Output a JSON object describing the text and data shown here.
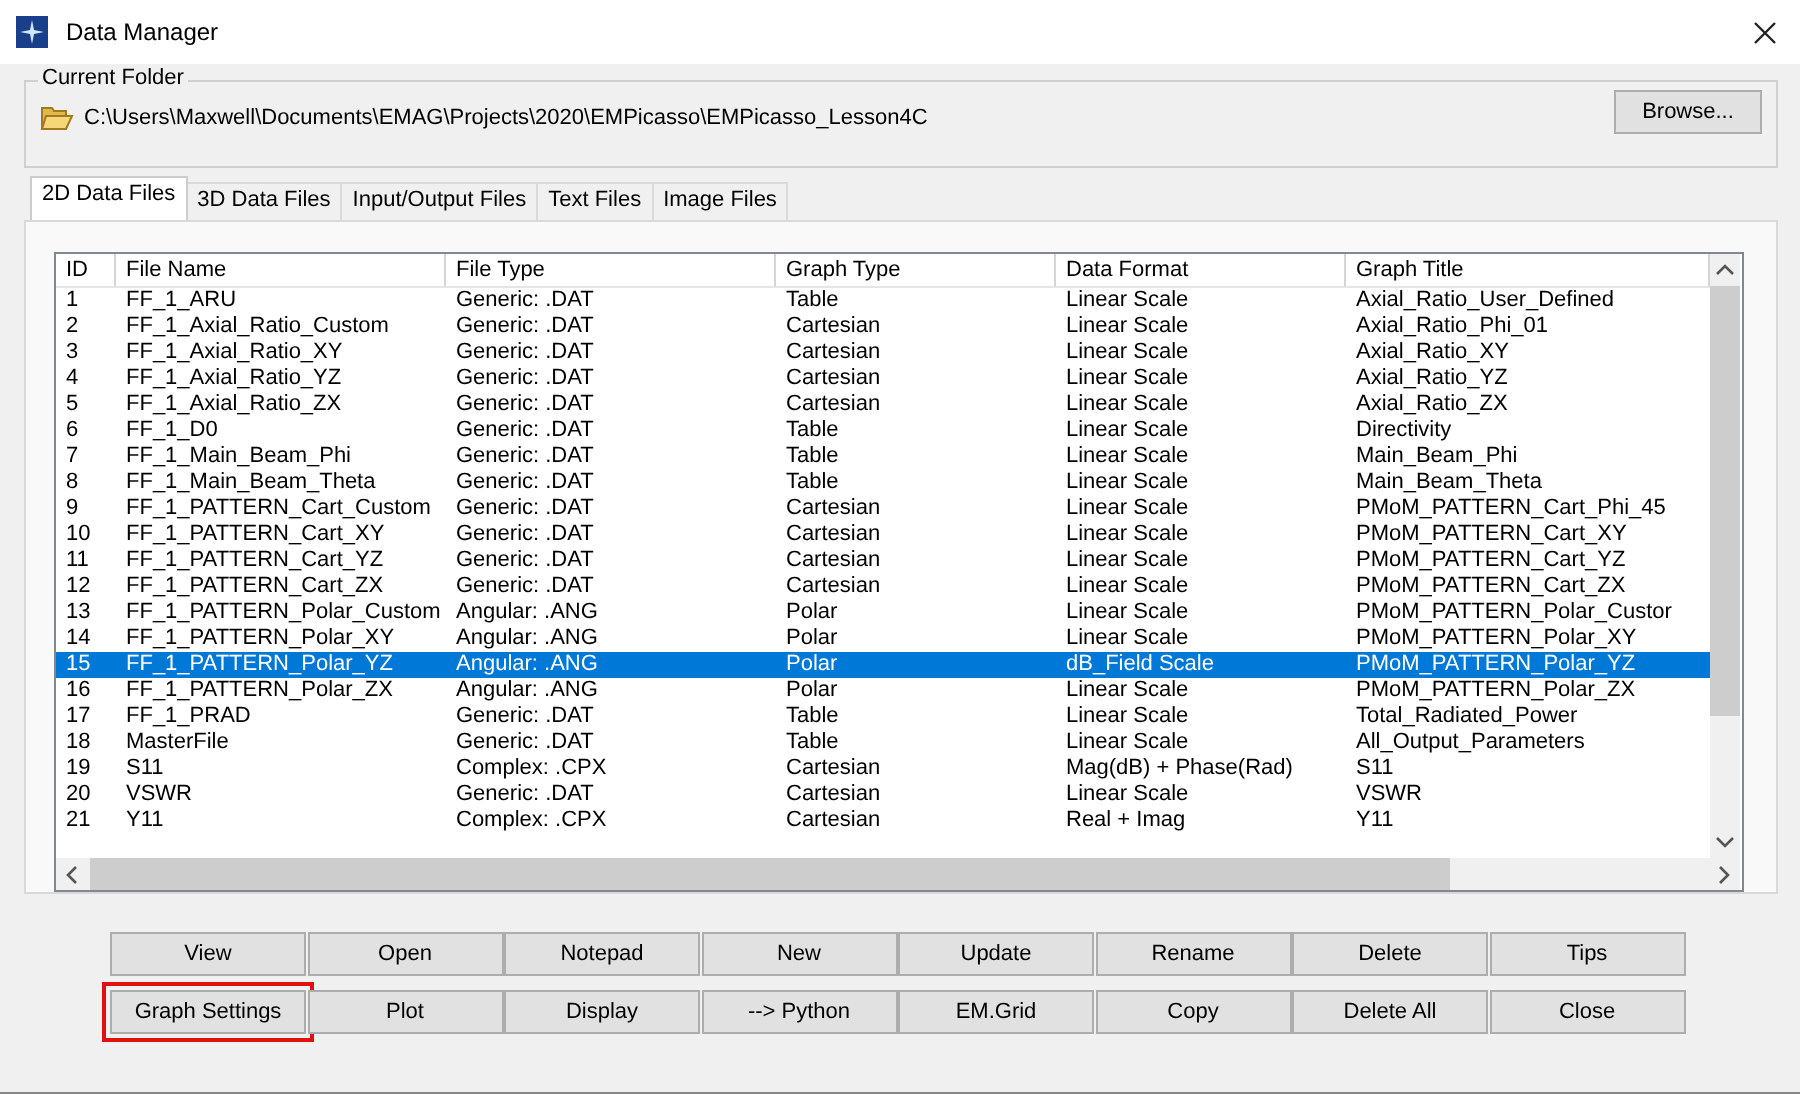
{
  "window": {
    "title": "Data Manager"
  },
  "current_folder": {
    "label": "Current Folder",
    "path": "C:\\Users\\Maxwell\\Documents\\EMAG\\Projects\\2020\\EMPicasso\\EMPicasso_Lesson4C",
    "browse_button": "Browse..."
  },
  "tabs": [
    {
      "label": "2D Data Files",
      "selected": true
    },
    {
      "label": "3D Data Files",
      "selected": false
    },
    {
      "label": "Input/Output Files",
      "selected": false
    },
    {
      "label": "Text Files",
      "selected": false
    },
    {
      "label": "Image Files",
      "selected": false
    }
  ],
  "table": {
    "columns": [
      "ID",
      "File Name",
      "File Type",
      "Graph Type",
      "Data Format",
      "Graph Title"
    ],
    "rows": [
      {
        "cells": [
          "1",
          "FF_1_ARU",
          "Generic: .DAT",
          "Table",
          "Linear Scale",
          "Axial_Ratio_User_Defined"
        ],
        "selected": false
      },
      {
        "cells": [
          "2",
          "FF_1_Axial_Ratio_Custom",
          "Generic: .DAT",
          "Cartesian",
          "Linear Scale",
          "Axial_Ratio_Phi_01"
        ],
        "selected": false
      },
      {
        "cells": [
          "3",
          "FF_1_Axial_Ratio_XY",
          "Generic: .DAT",
          "Cartesian",
          "Linear Scale",
          "Axial_Ratio_XY"
        ],
        "selected": false
      },
      {
        "cells": [
          "4",
          "FF_1_Axial_Ratio_YZ",
          "Generic: .DAT",
          "Cartesian",
          "Linear Scale",
          "Axial_Ratio_YZ"
        ],
        "selected": false
      },
      {
        "cells": [
          "5",
          "FF_1_Axial_Ratio_ZX",
          "Generic: .DAT",
          "Cartesian",
          "Linear Scale",
          "Axial_Ratio_ZX"
        ],
        "selected": false
      },
      {
        "cells": [
          "6",
          "FF_1_D0",
          "Generic: .DAT",
          "Table",
          "Linear Scale",
          "Directivity"
        ],
        "selected": false
      },
      {
        "cells": [
          "7",
          "FF_1_Main_Beam_Phi",
          "Generic: .DAT",
          "Table",
          "Linear Scale",
          "Main_Beam_Phi"
        ],
        "selected": false
      },
      {
        "cells": [
          "8",
          "FF_1_Main_Beam_Theta",
          "Generic: .DAT",
          "Table",
          "Linear Scale",
          "Main_Beam_Theta"
        ],
        "selected": false
      },
      {
        "cells": [
          "9",
          "FF_1_PATTERN_Cart_Custom",
          "Generic: .DAT",
          "Cartesian",
          "Linear Scale",
          "PMoM_PATTERN_Cart_Phi_45"
        ],
        "selected": false
      },
      {
        "cells": [
          "10",
          "FF_1_PATTERN_Cart_XY",
          "Generic: .DAT",
          "Cartesian",
          "Linear Scale",
          "PMoM_PATTERN_Cart_XY"
        ],
        "selected": false
      },
      {
        "cells": [
          "11",
          "FF_1_PATTERN_Cart_YZ",
          "Generic: .DAT",
          "Cartesian",
          "Linear Scale",
          "PMoM_PATTERN_Cart_YZ"
        ],
        "selected": false
      },
      {
        "cells": [
          "12",
          "FF_1_PATTERN_Cart_ZX",
          "Generic: .DAT",
          "Cartesian",
          "Linear Scale",
          "PMoM_PATTERN_Cart_ZX"
        ],
        "selected": false
      },
      {
        "cells": [
          "13",
          "FF_1_PATTERN_Polar_Custom",
          "Angular: .ANG",
          "Polar",
          "Linear Scale",
          "PMoM_PATTERN_Polar_Custor"
        ],
        "selected": false
      },
      {
        "cells": [
          "14",
          "FF_1_PATTERN_Polar_XY",
          "Angular: .ANG",
          "Polar",
          "Linear Scale",
          "PMoM_PATTERN_Polar_XY"
        ],
        "selected": false
      },
      {
        "cells": [
          "15",
          "FF_1_PATTERN_Polar_YZ",
          "Angular: .ANG",
          "Polar",
          "dB_Field Scale",
          "PMoM_PATTERN_Polar_YZ"
        ],
        "selected": true
      },
      {
        "cells": [
          "16",
          "FF_1_PATTERN_Polar_ZX",
          "Angular: .ANG",
          "Polar",
          "Linear Scale",
          "PMoM_PATTERN_Polar_ZX"
        ],
        "selected": false
      },
      {
        "cells": [
          "17",
          "FF_1_PRAD",
          "Generic: .DAT",
          "Table",
          "Linear Scale",
          "Total_Radiated_Power"
        ],
        "selected": false
      },
      {
        "cells": [
          "18",
          "MasterFile",
          "Generic: .DAT",
          "Table",
          "Linear Scale",
          "All_Output_Parameters"
        ],
        "selected": false
      },
      {
        "cells": [
          "19",
          "S11",
          "Complex: .CPX",
          "Cartesian",
          "Mag(dB) + Phase(Rad)",
          "S11"
        ],
        "selected": false
      },
      {
        "cells": [
          "20",
          "VSWR",
          "Generic: .DAT",
          "Cartesian",
          "Linear Scale",
          "VSWR"
        ],
        "selected": false
      },
      {
        "cells": [
          "21",
          "Y11",
          "Complex: .CPX",
          "Cartesian",
          "Real + Imag",
          "Y11"
        ],
        "selected": false
      }
    ]
  },
  "buttons": [
    {
      "label": "View",
      "highlighted": false
    },
    {
      "label": "Open",
      "highlighted": false
    },
    {
      "label": "Notepad",
      "highlighted": false
    },
    {
      "label": "New",
      "highlighted": false
    },
    {
      "label": "Update",
      "highlighted": false
    },
    {
      "label": "Rename",
      "highlighted": false
    },
    {
      "label": "Delete",
      "highlighted": false
    },
    {
      "label": "Tips",
      "highlighted": false
    },
    {
      "label": "Graph Settings",
      "highlighted": true
    },
    {
      "label": "Plot",
      "highlighted": false
    },
    {
      "label": "Display",
      "highlighted": false
    },
    {
      "label": "--> Python",
      "highlighted": false
    },
    {
      "label": "EM.Grid",
      "highlighted": false
    },
    {
      "label": "Copy",
      "highlighted": false
    },
    {
      "label": "Delete All",
      "highlighted": false
    },
    {
      "label": "Close",
      "highlighted": false
    }
  ]
}
